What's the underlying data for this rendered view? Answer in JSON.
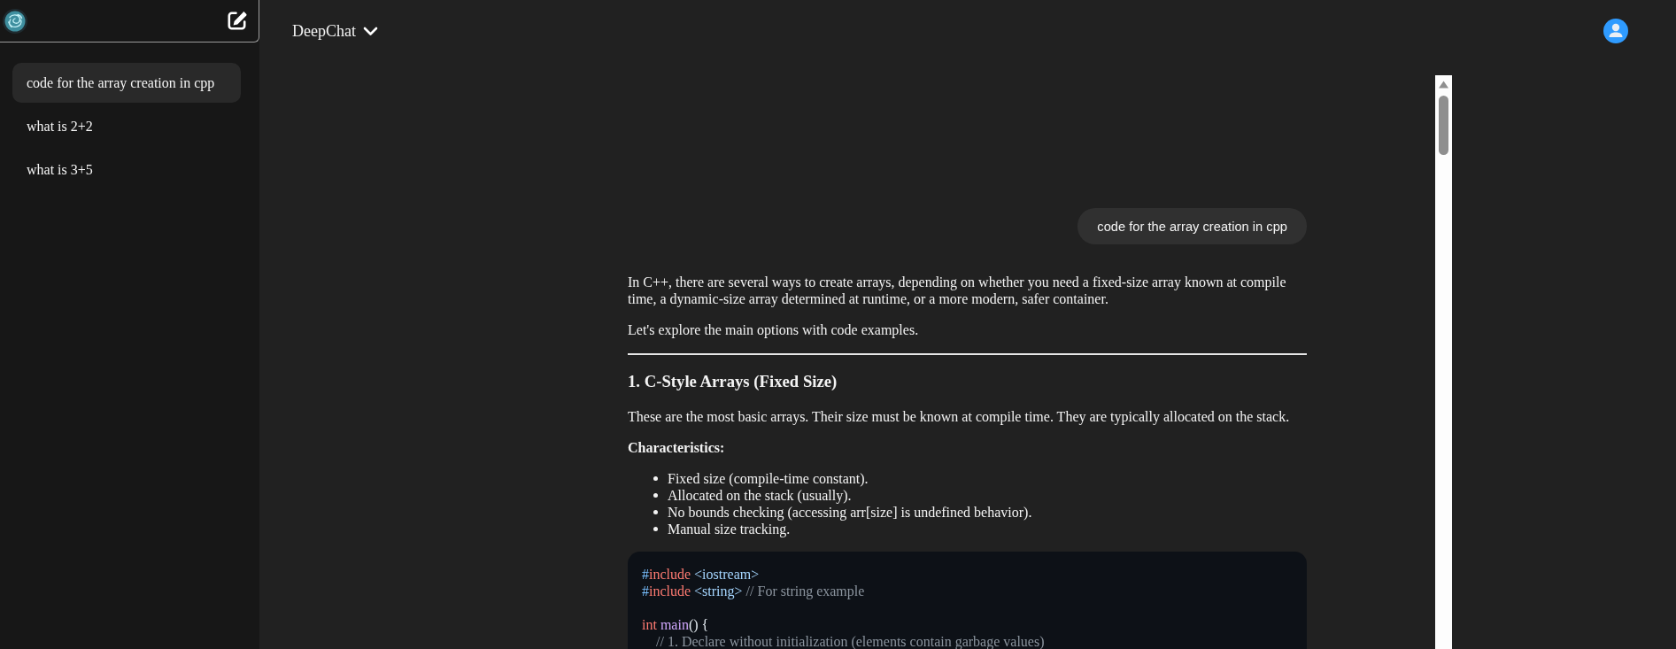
{
  "sidebar": {
    "items": [
      {
        "label": "code for the array creation in cpp",
        "selected": true
      },
      {
        "label": "what is 2+2",
        "selected": false
      },
      {
        "label": "what is 3+5",
        "selected": false
      }
    ]
  },
  "header": {
    "model_name": "DeepChat"
  },
  "chat": {
    "messages": [
      {
        "kind": "user",
        "text": "code for the array creation in cpp"
      },
      {
        "kind": "assistant",
        "blocks": [
          {
            "kind": "paragraph",
            "text": "In C++, there are several ways to create arrays, depending on whether you need a fixed-size array known at compile time, a dynamic-size array determined at runtime, or a more modern, safer container."
          },
          {
            "kind": "paragraph",
            "text": "Let's explore the main options with code examples."
          },
          {
            "kind": "rule"
          },
          {
            "kind": "heading",
            "text": "1. C-Style Arrays (Fixed Size)"
          },
          {
            "kind": "paragraph",
            "text": "These are the most basic arrays. Their size must be known at compile time. They are typically allocated on the stack."
          },
          {
            "kind": "label",
            "text": "Characteristics:"
          },
          {
            "kind": "list",
            "items": [
              "Fixed size (compile-time constant).",
              "Allocated on the stack (usually).",
              "No bounds checking (accessing arr[size] is undefined behavior).",
              "Manual size tracking."
            ]
          },
          {
            "kind": "code",
            "lines": [
              {
                "kind": "code",
                "tokens": [
                  {
                    "kind": "mark",
                    "text": "#"
                  },
                  {
                    "kind": "keyword",
                    "text": "include"
                  },
                  {
                    "kind": "header",
                    "text": " <iostream>"
                  }
                ]
              },
              {
                "kind": "code",
                "tokens": [
                  {
                    "kind": "mark",
                    "text": "#"
                  },
                  {
                    "kind": "keyword",
                    "text": "include"
                  },
                  {
                    "kind": "header",
                    "text": " <string>"
                  },
                  {
                    "kind": "comment",
                    "text": " // For string example"
                  }
                ]
              },
              {
                "kind": "blank"
              },
              {
                "kind": "code",
                "tokens": [
                  {
                    "kind": "keyword",
                    "text": "int "
                  },
                  {
                    "kind": "function",
                    "text": "main"
                  },
                  {
                    "kind": "plain",
                    "text": "() {"
                  }
                ]
              },
              {
                "kind": "code",
                "tokens": [
                  {
                    "kind": "comment",
                    "text": "    // 1. Declare without initialization (elements contain garbage values)"
                  }
                ]
              }
            ]
          }
        ]
      }
    ]
  }
}
